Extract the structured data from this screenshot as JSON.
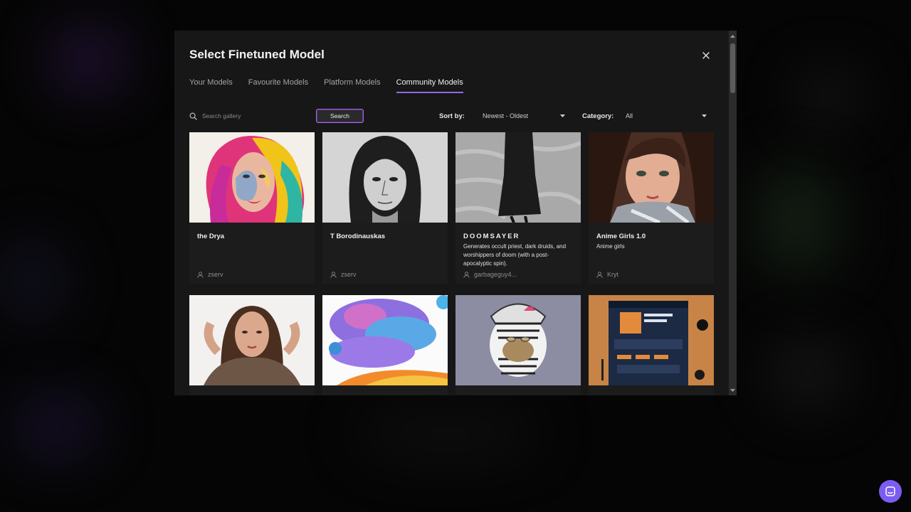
{
  "modal": {
    "title": "Select Finetuned Model",
    "tabs": [
      {
        "label": "Your Models",
        "active": false
      },
      {
        "label": "Favourite Models",
        "active": false
      },
      {
        "label": "Platform Models",
        "active": false
      },
      {
        "label": "Community Models",
        "active": true
      }
    ]
  },
  "toolbar": {
    "search_placeholder": "Search gallery",
    "search_label": "Search",
    "sort_label": "Sort by:",
    "sort_value": "Newest - Oldest",
    "category_label": "Category:",
    "category_value": "All"
  },
  "cards": [
    {
      "title": "the Drya",
      "description": "",
      "author": "zserv"
    },
    {
      "title": "T Borodinauskas",
      "description": "",
      "author": "zserv"
    },
    {
      "title": "DOOMSAYER",
      "description": "Generates occult priest, dark druids, and worshippers of doom (with a post-apocalyptic spin).",
      "author": "garbageguy4..."
    },
    {
      "title": "Anime Girls 1.0",
      "description": "Anime girls",
      "author": "Kryt"
    }
  ],
  "icons": {
    "search": "search-icon",
    "close": "close-icon",
    "caret": "caret-down-icon",
    "user": "user-icon",
    "chat": "chat-icon"
  },
  "colors": {
    "accent": "#8f6ae8",
    "search_border": "#a363e6",
    "chat_button": "#7d5cf2",
    "modal_bg": "#171717",
    "card_bg": "#1c1c1c"
  }
}
